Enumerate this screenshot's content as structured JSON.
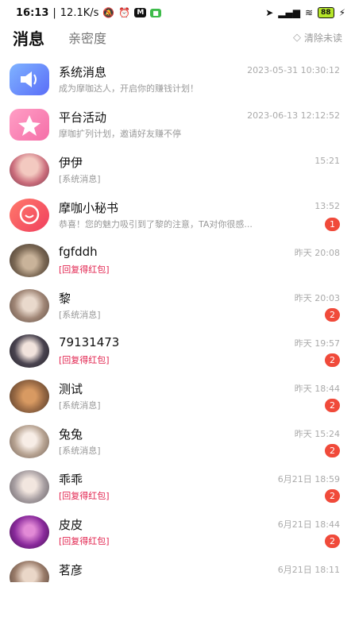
{
  "status": {
    "time": "16:13",
    "speed": "12.1K/s",
    "battery": "88",
    "icons": [
      "mute-bell-icon",
      "alarm-icon",
      "m-app-icon",
      "g-app-icon",
      "location-icon",
      "signal-icon",
      "wifi-icon",
      "battery-icon",
      "charging-icon"
    ]
  },
  "tabs": {
    "active": "消息",
    "inactive": "亲密度",
    "clear": "清除未读"
  },
  "messages": [
    {
      "name": "系统消息",
      "sub": "成为摩咖达人，开启你的赚钱计划！",
      "time": "2023-05-31 10:30:12",
      "badge": "",
      "red": false
    },
    {
      "name": "平台活动",
      "sub": "摩咖扩列计划，邀请好友赚不停",
      "time": "2023-06-13 12:12:52",
      "badge": "",
      "red": false
    },
    {
      "name": "伊伊",
      "sub": "[系统消息]",
      "time": "15:21",
      "badge": "",
      "red": false
    },
    {
      "name": "摩咖小秘书",
      "sub": "恭喜！您的魅力吸引到了黎的注意，TA对你很感...",
      "time": "13:52",
      "badge": "1",
      "red": false
    },
    {
      "name": "fgfddh",
      "sub": "[回复得红包]",
      "time": "昨天 20:08",
      "badge": "",
      "red": true
    },
    {
      "name": "黎",
      "sub": "[系统消息]",
      "time": "昨天 20:03",
      "badge": "2",
      "red": false
    },
    {
      "name": "79131473",
      "sub": "[回复得红包]",
      "time": "昨天 19:57",
      "badge": "2",
      "red": true
    },
    {
      "name": "测试",
      "sub": "[系统消息]",
      "time": "昨天 18:44",
      "badge": "2",
      "red": false
    },
    {
      "name": "兔兔",
      "sub": "[系统消息]",
      "time": "昨天 15:24",
      "badge": "2",
      "red": false
    },
    {
      "name": "乖乖",
      "sub": "[回复得红包]",
      "time": "6月21日 18:59",
      "badge": "2",
      "red": true
    },
    {
      "name": "皮皮",
      "sub": "[回复得红包]",
      "time": "6月21日 18:44",
      "badge": "2",
      "red": true
    },
    {
      "name": "茗彦",
      "sub": "",
      "time": "6月21日 18:11",
      "badge": "",
      "red": false
    }
  ],
  "colors": {
    "badge": "#f04a3a",
    "red_text": "#e2244f"
  }
}
